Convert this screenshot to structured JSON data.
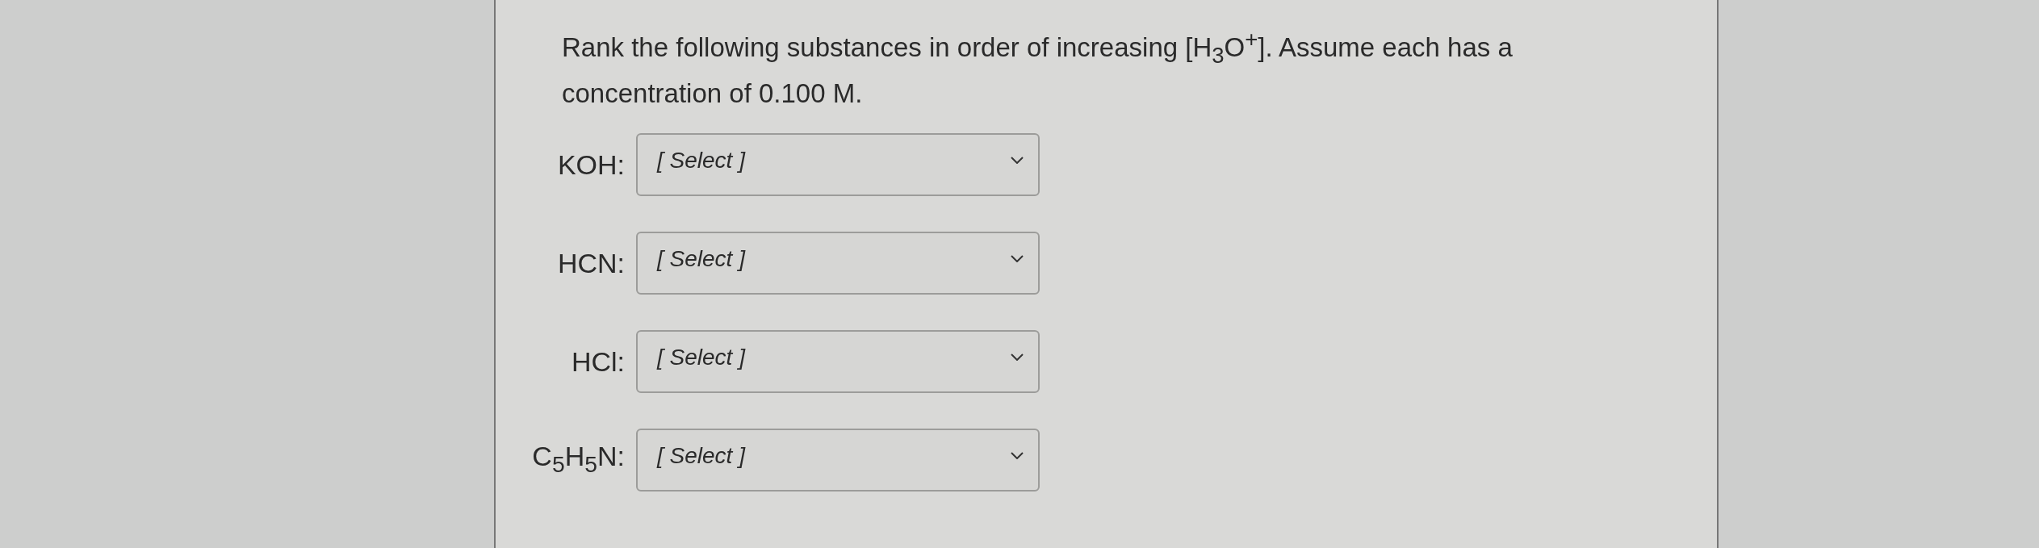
{
  "question": {
    "prompt": "Rank the following substances in order of increasing [H$_{3}$O$^{+}$]. Assume each has a concentration of 0.100 M.",
    "items": [
      {
        "label": "KOH:",
        "dropdown": {
          "placeholder": "[ Select ]"
        }
      },
      {
        "label": "HCN:",
        "dropdown": {
          "placeholder": "[ Select ]"
        }
      },
      {
        "label": "HCl:",
        "dropdown": {
          "placeholder": "[ Select ]"
        }
      },
      {
        "label": "C$_{5}$H$_{5}$N:",
        "dropdown": {
          "placeholder": "[ Select ]"
        }
      }
    ]
  }
}
